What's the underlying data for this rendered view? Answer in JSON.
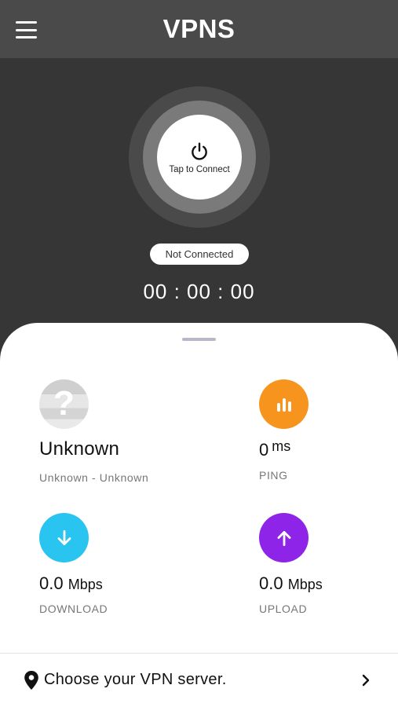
{
  "header": {
    "title": "VPNS",
    "menu_icon": "hamburger-menu-icon"
  },
  "connect": {
    "button_label": "Tap to Connect",
    "icon": "power-icon",
    "status": "Not Connected",
    "timer": "00 : 00 : 00"
  },
  "stats": {
    "location": {
      "name": "Unknown",
      "detail": "Unknown - Unknown",
      "icon": "question-mark-icon"
    },
    "ping": {
      "value": "0",
      "unit": "ms",
      "caption": "PING",
      "icon": "bar-chart-icon",
      "color": "#F7941D"
    },
    "download": {
      "value": "0.0",
      "unit": "Mbps",
      "caption": "DOWNLOAD",
      "icon": "arrow-down-icon",
      "color": "#29C5F0"
    },
    "upload": {
      "value": "0.0",
      "unit": "Mbps",
      "caption": "UPLOAD",
      "icon": "arrow-up-icon",
      "color": "#8E24E8"
    }
  },
  "server": {
    "label": "Choose your VPN server.",
    "icon": "map-pin-icon",
    "chevron": "chevron-right-icon"
  }
}
